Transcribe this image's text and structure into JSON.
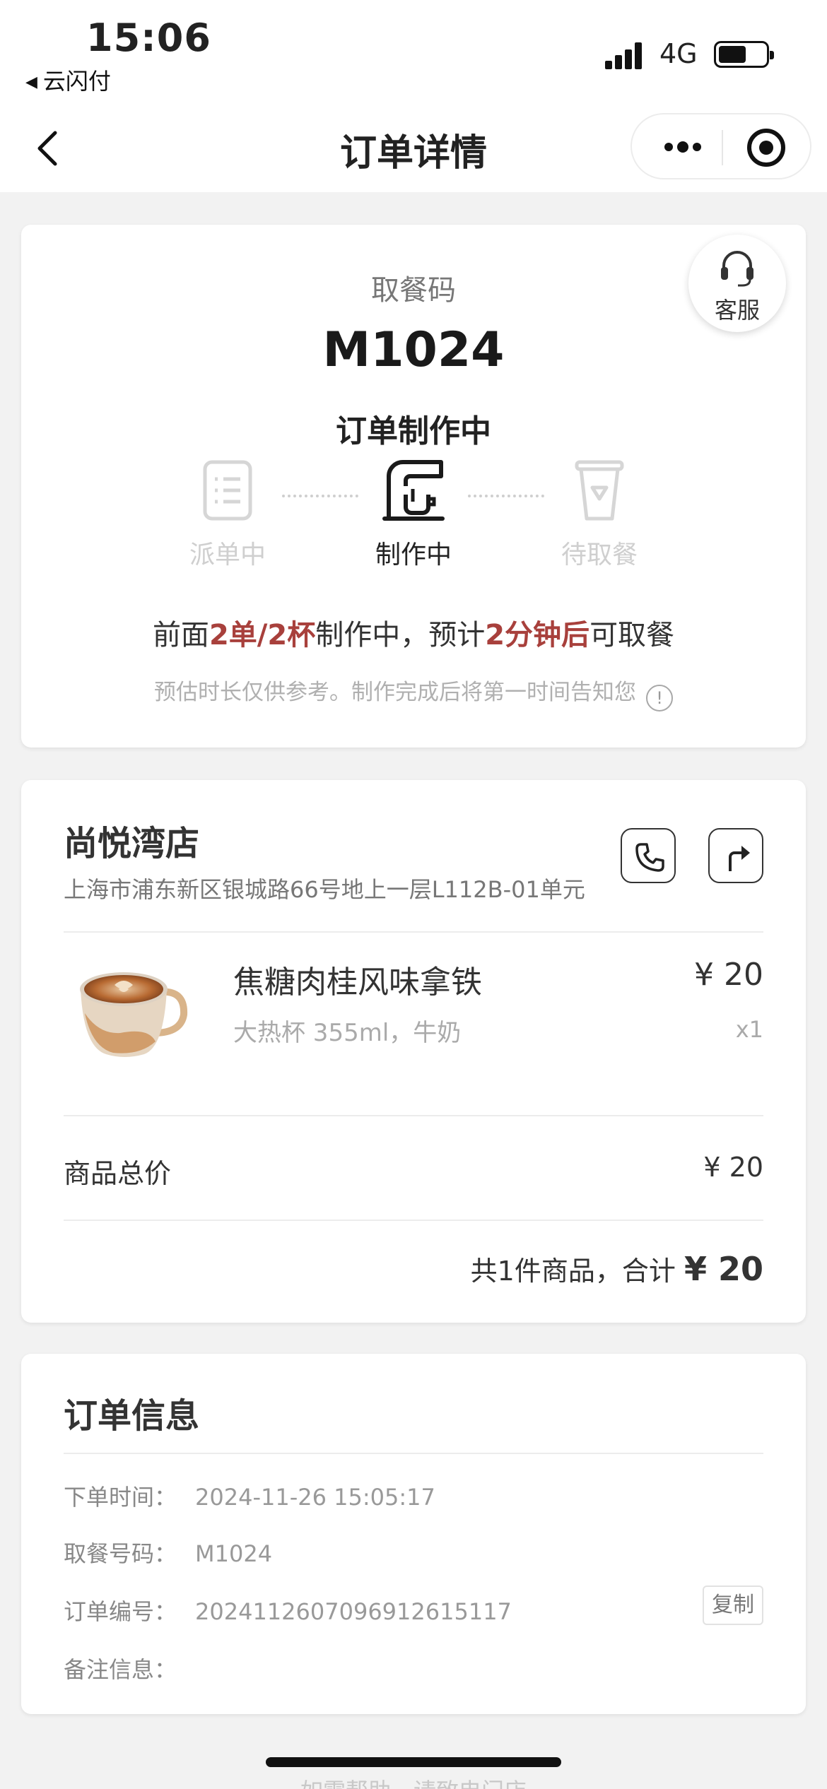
{
  "status_bar": {
    "time": "15:06",
    "back_app": "云闪付",
    "network": "4G",
    "battery_level": 0.5
  },
  "nav": {
    "title": "订单详情"
  },
  "pickup": {
    "support_label": "客服",
    "code_label": "取餐码",
    "code": "M1024",
    "status": "订单制作中",
    "steps": [
      {
        "label": "派单中",
        "state": "inactive",
        "icon": "receipt-icon"
      },
      {
        "label": "制作中",
        "state": "active",
        "icon": "coffee-machine-icon"
      },
      {
        "label": "待取餐",
        "state": "inactive",
        "icon": "cup-icon"
      }
    ],
    "queue": {
      "prefix": "前面",
      "count": "2单/2杯",
      "middle": "制作中，预计",
      "eta": "2分钟后",
      "suffix": "可取餐"
    },
    "note": "预估时长仅供参考。制作完成后将第一时间告知您",
    "note_icon": "!"
  },
  "store": {
    "name": "尚悦湾店",
    "address": "上海市浦东新区银城路66号地上一层L112B-01单元",
    "actions": [
      "phone-icon",
      "route-icon"
    ]
  },
  "product": {
    "name": "焦糖肉桂风味拿铁",
    "spec": "大热杯 355ml，牛奶",
    "price": "¥ 20",
    "qty": "x1"
  },
  "totals": {
    "subtotal_label": "商品总价",
    "subtotal_value": "¥ 20",
    "summary_text": "共1件商品，合计",
    "total": "¥ 20"
  },
  "order_info": {
    "title": "订单信息",
    "rows": [
      {
        "key": "下单时间：",
        "value": "2024-11-26 15:05:17"
      },
      {
        "key": "取餐号码：",
        "value": "M1024"
      },
      {
        "key": "订单编号：",
        "value": "20241126070969126151​17"
      },
      {
        "key": "备注信息：",
        "value": ""
      }
    ],
    "copy_label": "复制"
  },
  "footer_hint": "如需帮助，请致电门店",
  "colors": {
    "highlight": "#a8403c",
    "background": "#f2f2f2"
  }
}
